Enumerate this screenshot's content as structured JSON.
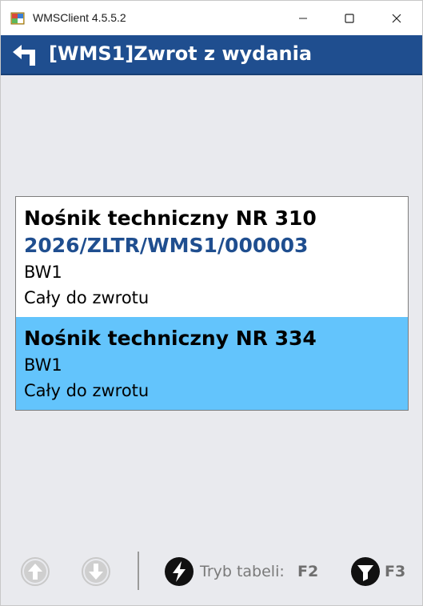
{
  "window": {
    "title": "WMSClient 4.5.5.2"
  },
  "header": {
    "title": "[WMS1]Zwrot z wydania"
  },
  "items": [
    {
      "title": "Nośnik techniczny NR 310",
      "document": "2026/ZLTR/WMS1/000003",
      "location": "BW1",
      "status": "Cały do zwrotu",
      "selected": false
    },
    {
      "title": "Nośnik techniczny NR 334",
      "location": "BW1",
      "status": "Cały do zwrotu",
      "selected": true
    }
  ],
  "toolbar": {
    "table_mode_label": "Tryb tabeli:",
    "table_mode_key": "F2",
    "filter_key": "F3",
    "icons": [
      "arrow-up-icon",
      "arrow-down-icon",
      "lightning-icon",
      "filter-icon"
    ]
  },
  "colors": {
    "header_bg": "#1f4e8f",
    "selected_bg": "#63c4fc",
    "document_text": "#1f4e8f"
  }
}
